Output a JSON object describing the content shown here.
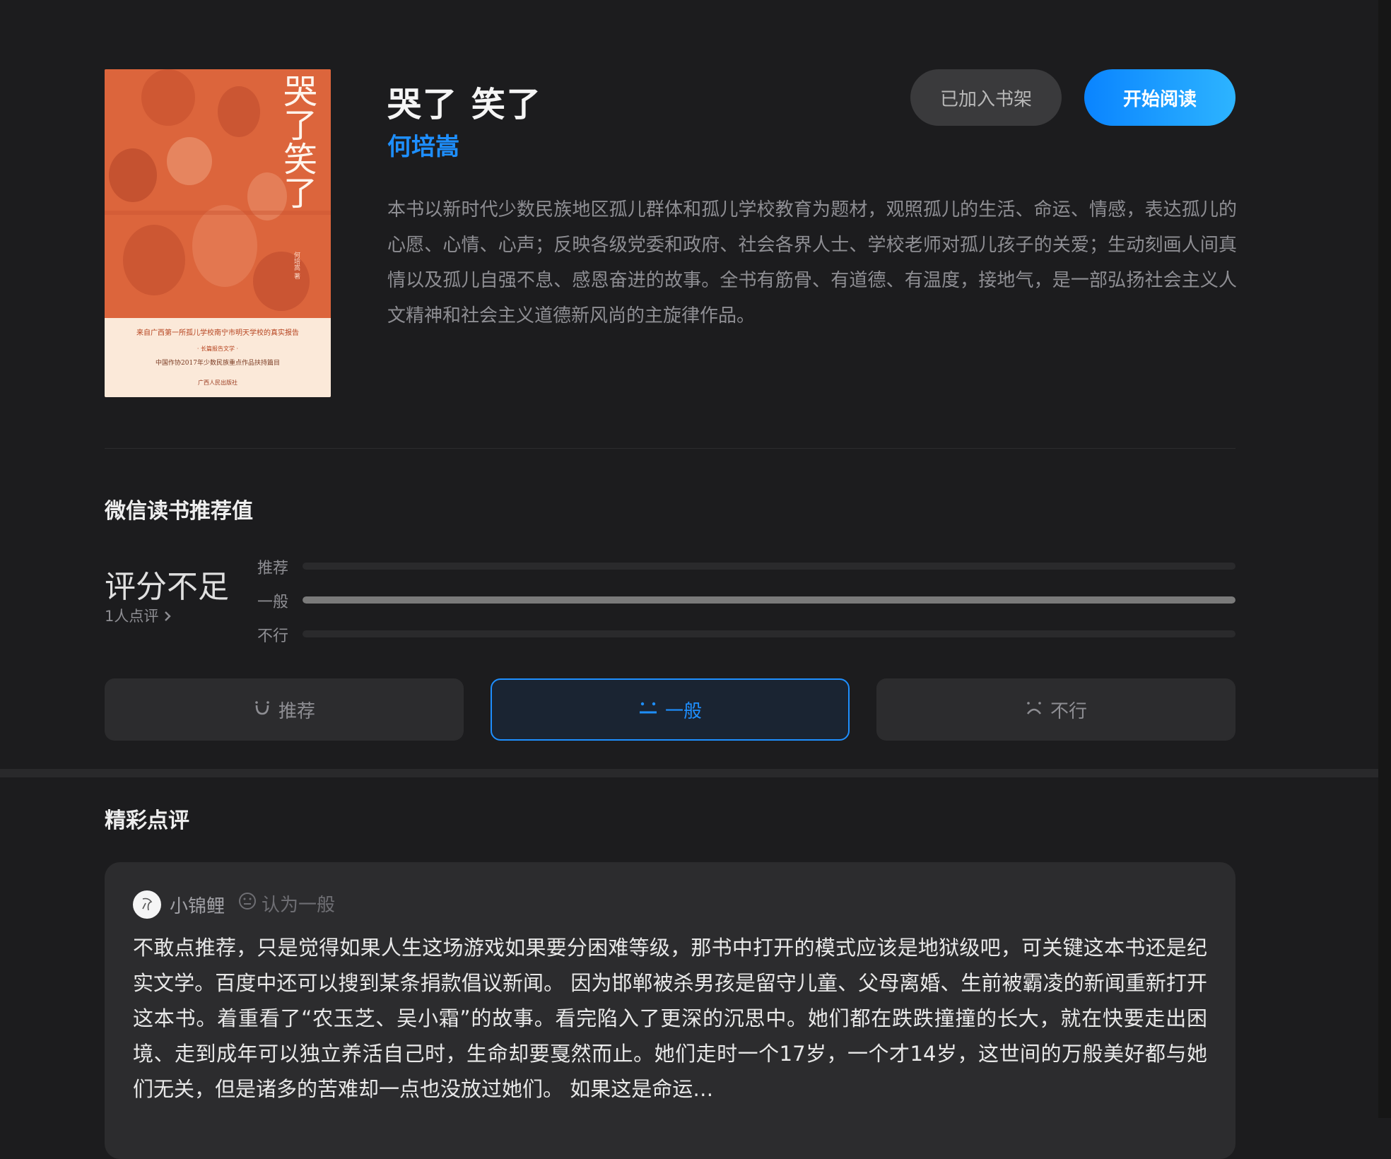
{
  "book": {
    "title": "哭了 笑了",
    "author": "何培嵩",
    "intro": "本书以新时代少数民族地区孤儿群体和孤儿学校教育为题材，观照孤儿的生活、命运、情感，表达孤儿的心愿、心情、心声；反映各级党委和政府、社会各界人士、学校老师对孤儿孩子的关爱；生动刻画人间真情以及孤儿自强不息、感恩奋进的故事。全书有筋骨、有道德、有温度，接地气，是一部弘扬社会主义人文精神和社会主义道德新风尚的主旋律作品。",
    "cover": {
      "title": "哭了笑了",
      "author_small": "何培嵩 著",
      "line1": "来自广西第一所孤儿学校南宁市明天学校的真实报告",
      "line2": "· 长篇报告文学 ·",
      "line3": "中国作协2017年少数民族重点作品扶持篇目",
      "publisher": "广西人民出版社"
    }
  },
  "actions": {
    "shelf_label": "已加入书架",
    "read_label": "开始阅读"
  },
  "rating": {
    "section_title": "微信读书推荐值",
    "score_text": "评分不足",
    "count_text": "1人点评",
    "bars": [
      {
        "label": "推荐",
        "fraction": 0
      },
      {
        "label": "一般",
        "fraction": 1
      },
      {
        "label": "不行",
        "fraction": 0
      }
    ],
    "vote_buttons": [
      {
        "label": "推荐",
        "icon": "smile-icon",
        "selected": false
      },
      {
        "label": "一般",
        "icon": "neutral-face-icon",
        "selected": true
      },
      {
        "label": "不行",
        "icon": "frown-icon",
        "selected": false
      }
    ]
  },
  "reviews": {
    "section_title": "精彩点评",
    "items": [
      {
        "name": "小锦鲤",
        "opinion": "认为一般",
        "text": "不敢点推荐，只是觉得如果人生这场游戏如果要分困难等级，那书中打开的模式应该是地狱级吧，可关键这本书还是纪实文学。百度中还可以搜到某条捐款倡议新闻。 因为邯郸被杀男孩是留守儿童、父母离婚、生前被霸凌的新闻重新打开这本书。着重看了“农玉芝、吴小霜”的故事。看完陷入了更深的沉思中。她们都在跌跌撞撞的长大，就在快要走出困境、走到成年可以独立养活自己时，生命却要戛然而止。她们走时一个17岁，一个才14岁，这世间的万般美好都与她们无关，但是诸多的苦难却一点也没放过她们。 如果这是命运…"
      }
    ]
  },
  "colors": {
    "accent": "#1e8fff",
    "background": "#1c1c1e",
    "card": "#2c2c2e"
  }
}
